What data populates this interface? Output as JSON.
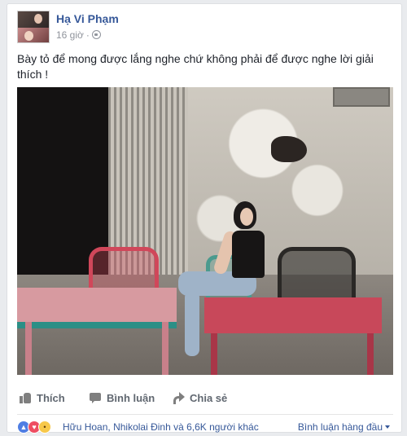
{
  "post": {
    "author": "Hạ Vi Phạm",
    "time": "16 giờ",
    "separator": "·",
    "privacy_icon": "globe-icon",
    "text": "Bày tỏ để mong được lắng nghe chứ không phải để được nghe lời giải thích !"
  },
  "actions": {
    "like_label": "Thích",
    "comment_label": "Bình luận",
    "share_label": "Chia sẻ"
  },
  "footer": {
    "reactions": [
      "like",
      "love",
      "wow"
    ],
    "reactors_text": "Hữu Hoan, Nhikolai Đinh và 6,6K người khác",
    "sort_label": "Bình luận hàng đầu"
  },
  "colors": {
    "link_blue": "#365899",
    "meta_gray": "#90949c",
    "action_gray": "#606770"
  }
}
